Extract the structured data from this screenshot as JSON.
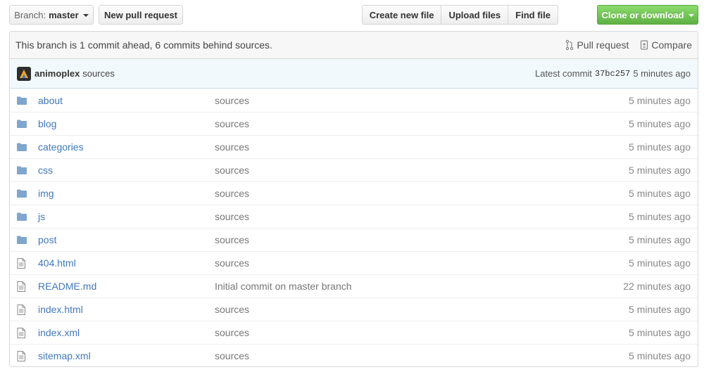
{
  "toolbar": {
    "branch_prefix": "Branch:",
    "branch_name": "master",
    "new_pull_request": "New pull request",
    "create_new_file": "Create new file",
    "upload_files": "Upload files",
    "find_file": "Find file",
    "clone_or_download": "Clone or download",
    "accent_green": "#6cc644"
  },
  "branch_info": {
    "text": "This branch is 1 commit ahead, 6 commits behind sources.",
    "pull_request": "Pull request",
    "compare": "Compare"
  },
  "commit": {
    "author": "animoplex",
    "message": "sources",
    "latest_label": "Latest commit",
    "sha": "37bc257",
    "age": "5 minutes ago"
  },
  "files": [
    {
      "type": "folder-icon",
      "name": "about",
      "message": "sources",
      "age": "5 minutes ago"
    },
    {
      "type": "folder-icon",
      "name": "blog",
      "message": "sources",
      "age": "5 minutes ago"
    },
    {
      "type": "folder-icon",
      "name": "categories",
      "message": "sources",
      "age": "5 minutes ago"
    },
    {
      "type": "folder-icon",
      "name": "css",
      "message": "sources",
      "age": "5 minutes ago"
    },
    {
      "type": "folder-icon",
      "name": "img",
      "message": "sources",
      "age": "5 minutes ago"
    },
    {
      "type": "folder-icon",
      "name": "js",
      "message": "sources",
      "age": "5 minutes ago"
    },
    {
      "type": "folder-icon",
      "name": "post",
      "message": "sources",
      "age": "5 minutes ago"
    },
    {
      "type": "file-icon",
      "name": "404.html",
      "message": "sources",
      "age": "5 minutes ago"
    },
    {
      "type": "file-icon",
      "name": "README.md",
      "message": "Initial commit on master branch",
      "age": "22 minutes ago"
    },
    {
      "type": "file-icon",
      "name": "index.html",
      "message": "sources",
      "age": "5 minutes ago"
    },
    {
      "type": "file-icon",
      "name": "index.xml",
      "message": "sources",
      "age": "5 minutes ago"
    },
    {
      "type": "file-icon",
      "name": "sitemap.xml",
      "message": "sources",
      "age": "5 minutes ago"
    }
  ]
}
